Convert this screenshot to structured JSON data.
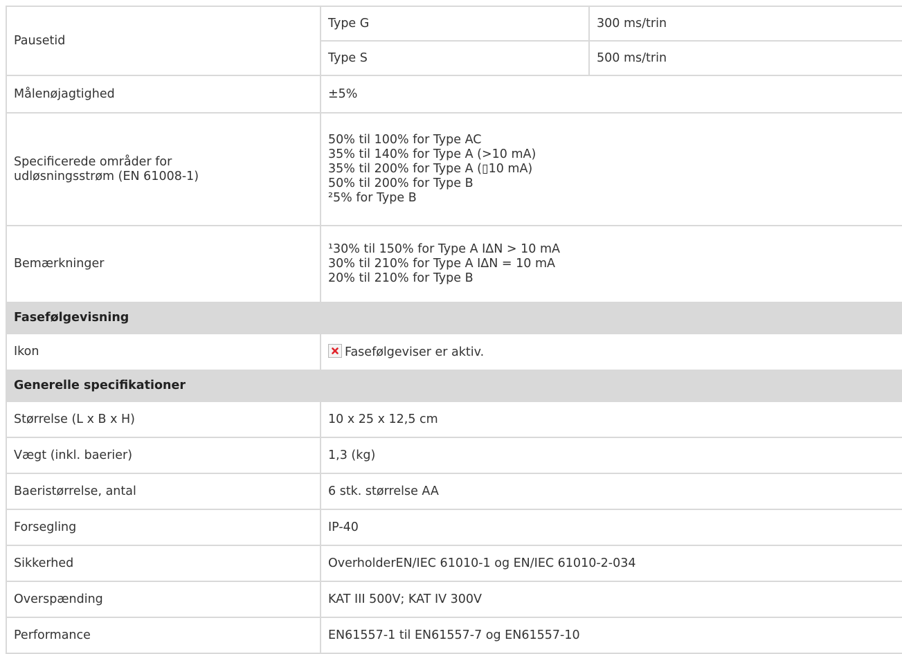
{
  "rows": {
    "pausetid": {
      "label": "Pausetid",
      "type_g": "Type G",
      "type_g_value": "300 ms/trin",
      "type_s": "Type S",
      "type_s_value": "500 ms/trin"
    },
    "accuracy": {
      "label": "Målenøjagtighed",
      "value": "±5%"
    },
    "ranges": {
      "label_line1": "Specificerede områder for",
      "label_line2": "udløsningsstrøm (EN 61008-1)",
      "lines": [
        "50% til 100% for Type AC",
        "35% til 140% for Type A (>10 mA)",
        "35% til 200% for Type A (▯10 mA)",
        "50% til 200% for Type B",
        "²5% for Type B"
      ]
    },
    "remarks": {
      "label": "Bemærkninger",
      "lines": [
        "¹30% til 150% for Type A IΔN > 10 mA",
        "30% til 210% for Type A IΔN = 10 mA",
        "20% til 210% for Type B"
      ]
    }
  },
  "phase_section": {
    "title": "Fasefølgevisning",
    "icon_label": "Ikon",
    "icon_text": "Fasefølgeviser er aktiv."
  },
  "general_section": {
    "title": "Generelle specifikationer",
    "rows": [
      {
        "label": "Størrelse (L x B x H)",
        "value": "10 x 25 x 12,5 cm"
      },
      {
        "label": "Vægt (inkl. baerier)",
        "value": "1,3 (kg)"
      },
      {
        "label": "Baeristørrelse, antal",
        "value": "6 stk. størrelse AA"
      },
      {
        "label": "Forsegling",
        "value": "IP-40"
      },
      {
        "label": "Sikkerhed",
        "value": "OverholderEN/IEC 61010-1 og EN/IEC 61010-2-034"
      },
      {
        "label": "Overspænding",
        "value": "KAT III 500V; KAT IV 300V"
      },
      {
        "label": "Performance",
        "value": "EN61557-1 til EN61557-7  og EN61557-10"
      }
    ]
  },
  "colors": {
    "border": "#d9d9d9",
    "section_bg": "#d9d9d9",
    "text": "#333333",
    "icon_x": "#e0242b"
  },
  "icons": {
    "broken_image": "broken-image-icon"
  }
}
